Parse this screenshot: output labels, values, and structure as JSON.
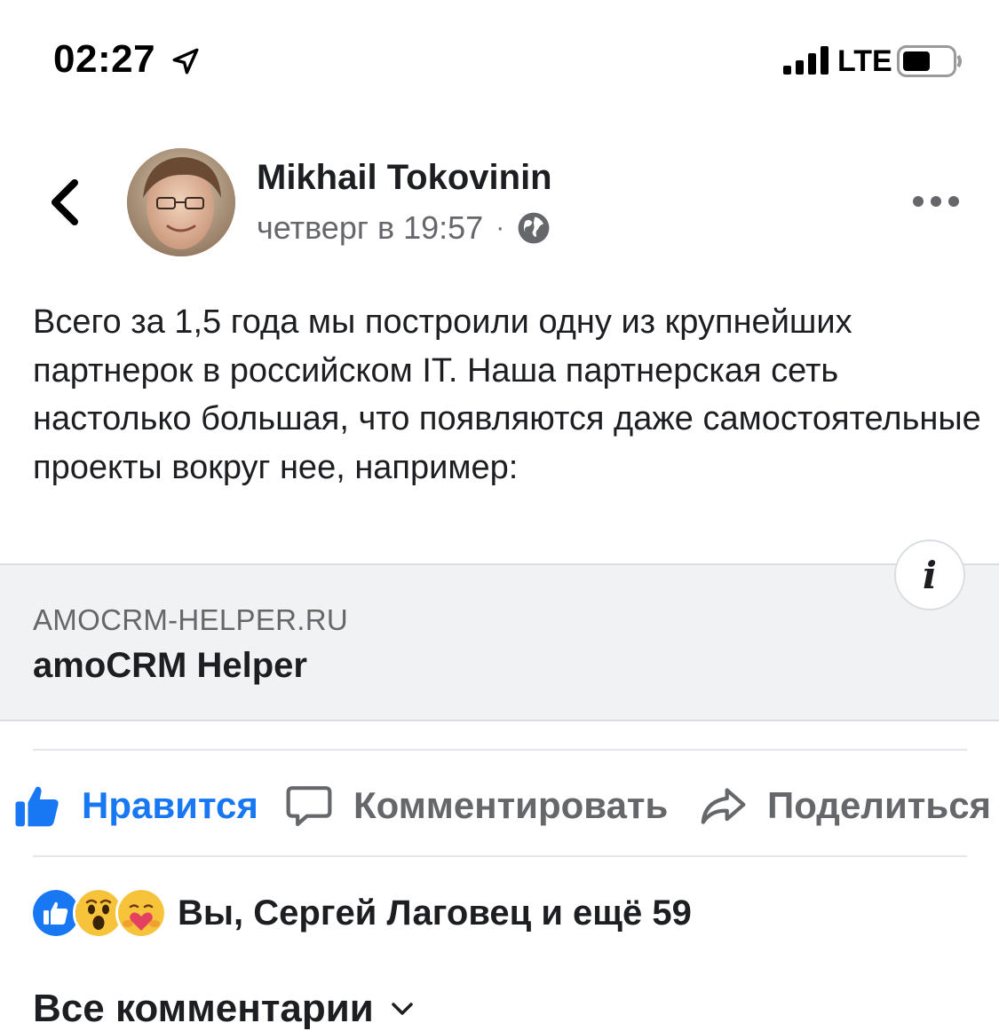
{
  "status_bar": {
    "time": "02:27",
    "network": "LTE"
  },
  "post": {
    "author": "Mikhail Tokovinin",
    "timestamp": "четверг в 19:57",
    "separator": "·",
    "text": "Всего за 1,5 года мы построили одну из крупнейших партнерок в российском IT. Наша партнерская сеть настолько большая, что появляются даже самостоятельные проекты вокруг нее, например:"
  },
  "link_preview": {
    "domain": "AMOCRM-HELPER.RU",
    "title": "amoCRM Helper",
    "info_label": "i"
  },
  "actions": {
    "like": "Нравится",
    "comment": "Комментировать",
    "share": "Поделиться"
  },
  "reactions": {
    "icons": [
      "like-icon",
      "wow-icon",
      "care-icon"
    ],
    "summary": "Вы, Сергей Лаговец и ещё 59"
  },
  "comments": {
    "all_comments_label": "Все комментарии"
  },
  "colors": {
    "accent": "#1877f2",
    "secondary_text": "#65676b",
    "card_background": "#f1f2f4"
  }
}
